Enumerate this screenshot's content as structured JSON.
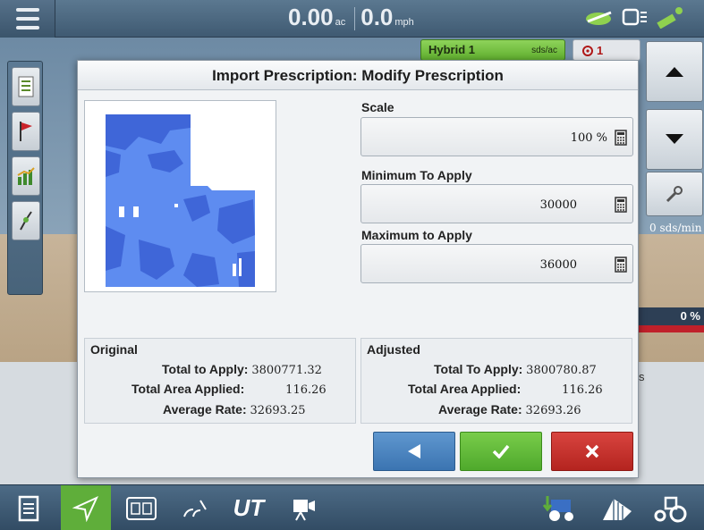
{
  "topbar": {
    "area_value": "0.00",
    "area_unit": "ac",
    "speed_value": "0.0",
    "speed_unit": "mph"
  },
  "product_chip": {
    "name": "Hybrid 1",
    "unit": "sds/ac"
  },
  "alarm_chip": {
    "count": "1"
  },
  "right_panel": {
    "rate_text": "0 sds/min",
    "percent_text": "0 %",
    "partial_text": "s"
  },
  "modal": {
    "title": "Import Prescription: Modify Prescription",
    "scale": {
      "label": "Scale",
      "value": "100 %"
    },
    "minimum": {
      "label": "Minimum To Apply",
      "value": "30000"
    },
    "maximum": {
      "label": "Maximum to Apply",
      "value": "36000"
    },
    "original": {
      "heading": "Original",
      "total_label": "Total to Apply:",
      "total_value": "3800771.32",
      "area_label": "Total Area Applied:",
      "area_value": "116.26",
      "avg_label": "Average Rate:",
      "avg_value": "32693.25"
    },
    "adjusted": {
      "heading": "Adjusted",
      "total_label": "Total To Apply:",
      "total_value": "3800780.87",
      "area_label": "Total Area Applied:",
      "area_value": "116.26",
      "avg_label": "Average Rate:",
      "avg_value": "32693.26"
    }
  },
  "bottombar": {
    "ut_label": "UT"
  },
  "colors": {
    "map_high": "#3f66d8",
    "map_low": "#5e8cf0",
    "back": "#4a83c0",
    "accept": "#5fb63a",
    "cancel": "#c4302b",
    "active_tab": "#5fae3a"
  }
}
